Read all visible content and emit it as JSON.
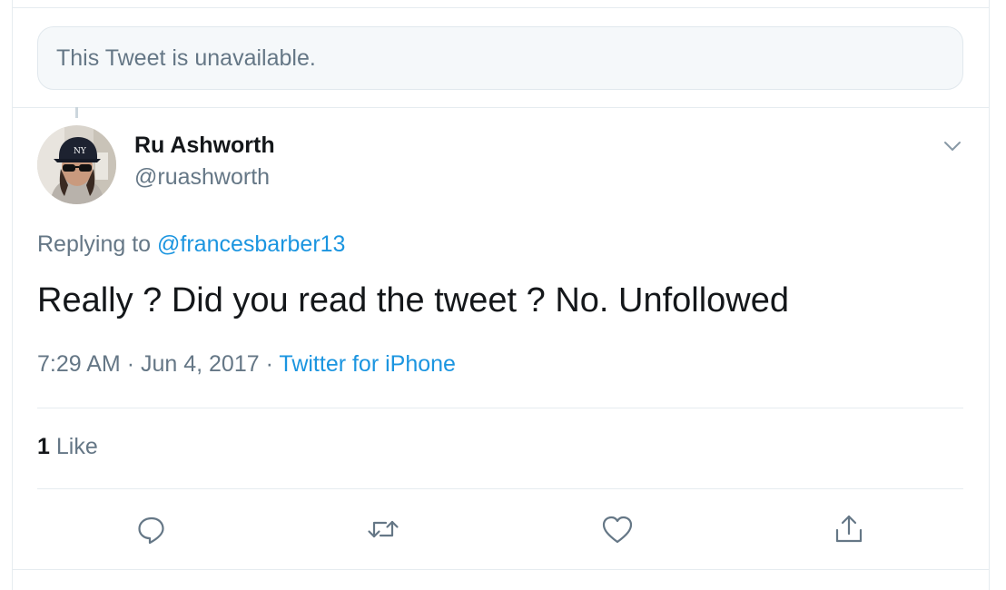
{
  "unavailable_notice": "This Tweet is unavailable.",
  "tweet": {
    "author_name": "Ru Ashworth",
    "author_handle": "@ruashworth",
    "replying_prefix": "Replying to",
    "replying_to": "@francesbarber13",
    "text": "Really ? Did you read the tweet ? No. Unfollowed",
    "time": "7:29 AM",
    "date": "Jun 4, 2017",
    "source": "Twitter for iPhone",
    "likes_count": "1",
    "likes_label": "Like"
  },
  "icons": {
    "menu": "chevron-down-icon",
    "reply": "reply-icon",
    "retweet": "retweet-icon",
    "like": "heart-icon",
    "share": "share-icon"
  },
  "colors": {
    "link": "#1b95e0",
    "secondary_text": "#657786",
    "primary_text": "#14171a",
    "icon": "#657786",
    "border": "#e6ecf0"
  }
}
